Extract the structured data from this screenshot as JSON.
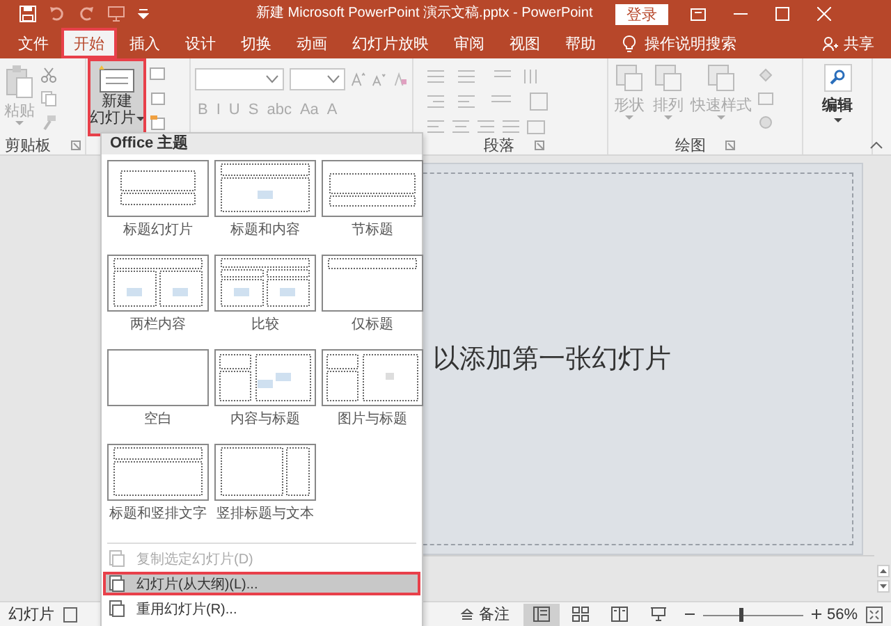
{
  "title_bar": {
    "title": "新建 Microsoft PowerPoint 演示文稿.pptx  -  PowerPoint",
    "login": "登录"
  },
  "tabs": [
    {
      "label": "文件",
      "selected": false,
      "highlighted": false
    },
    {
      "label": "开始",
      "selected": true,
      "highlighted": true
    },
    {
      "label": "插入",
      "selected": false,
      "highlighted": false
    },
    {
      "label": "设计",
      "selected": false,
      "highlighted": false
    },
    {
      "label": "切换",
      "selected": false,
      "highlighted": false
    },
    {
      "label": "动画",
      "selected": false,
      "highlighted": false
    },
    {
      "label": "幻灯片放映",
      "selected": false,
      "highlighted": false
    },
    {
      "label": "审阅",
      "selected": false,
      "highlighted": false
    },
    {
      "label": "视图",
      "selected": false,
      "highlighted": false
    },
    {
      "label": "帮助",
      "selected": false,
      "highlighted": false
    }
  ],
  "tell_me": "操作说明搜索",
  "share": "共享",
  "ribbon": {
    "clipboard": {
      "paste": "粘贴",
      "label": "剪贴板"
    },
    "new_slide": {
      "line1": "新建",
      "line2": "幻灯片",
      "highlighted": true
    },
    "font": {
      "buttons": [
        "B",
        "I",
        "U",
        "S",
        "abc",
        "Aa",
        "A"
      ]
    },
    "paragraph": {
      "label": "段落"
    },
    "drawing": {
      "items": [
        "形状",
        "排列",
        "快速样式"
      ],
      "label": "绘图"
    },
    "editing": {
      "label": "编辑"
    }
  },
  "gallery": {
    "header": "Office 主题",
    "layouts": [
      {
        "label": "标题幻灯片",
        "kind": "title"
      },
      {
        "label": "标题和内容",
        "kind": "title_content"
      },
      {
        "label": "节标题",
        "kind": "section"
      },
      {
        "label": "两栏内容",
        "kind": "two_content"
      },
      {
        "label": "比较",
        "kind": "comparison"
      },
      {
        "label": "仅标题",
        "kind": "title_only"
      },
      {
        "label": "空白",
        "kind": "blank"
      },
      {
        "label": "内容与标题",
        "kind": "content_caption"
      },
      {
        "label": "图片与标题",
        "kind": "picture_caption"
      },
      {
        "label": "标题和竖排文字",
        "kind": "title_vertical"
      },
      {
        "label": "竖排标题与文本",
        "kind": "vertical_title"
      }
    ],
    "menu": [
      {
        "label": "复制选定幻灯片(D)",
        "disabled": true,
        "selected": false,
        "highlighted": false
      },
      {
        "label": "幻灯片(从大纲)(L)...",
        "disabled": false,
        "selected": true,
        "highlighted": true
      },
      {
        "label": "重用幻灯片(R)...",
        "disabled": false,
        "selected": false,
        "highlighted": false
      }
    ]
  },
  "slide": {
    "placeholder": "以添加第一张幻灯片"
  },
  "status_bar": {
    "slide": "幻灯片",
    "notes": "备注",
    "views": [
      {
        "kind": "normal",
        "selected": true
      },
      {
        "kind": "sorter",
        "selected": false
      },
      {
        "kind": "reading",
        "selected": false
      },
      {
        "kind": "show",
        "selected": false
      }
    ],
    "zoom": {
      "level": 0.37,
      "reading": "56%"
    }
  }
}
